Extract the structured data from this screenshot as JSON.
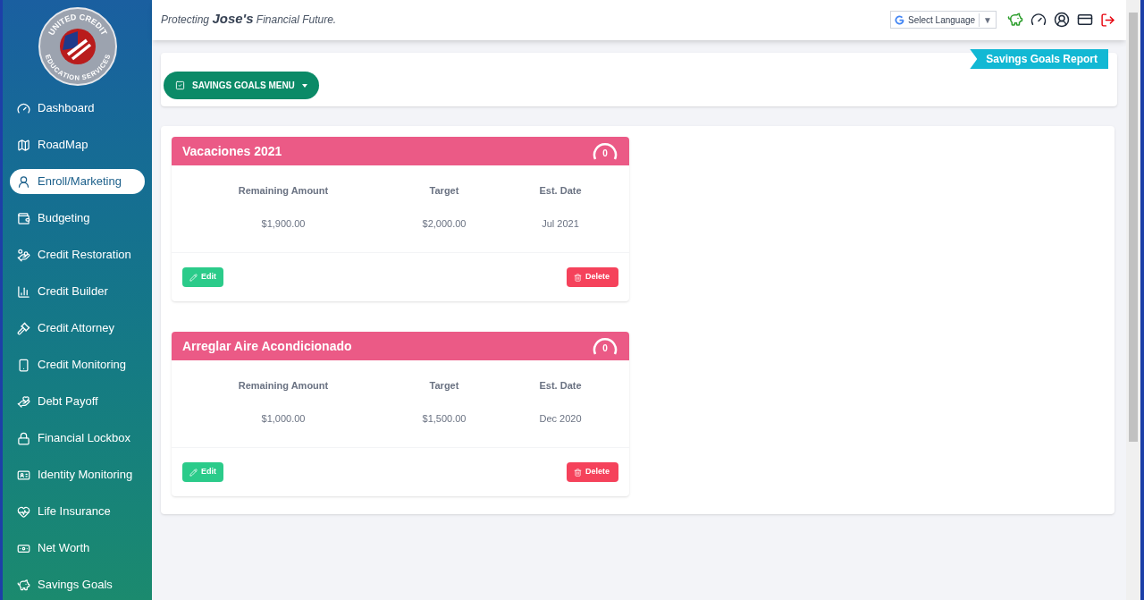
{
  "logo": {
    "text_top": "UNITED CREDIT",
    "text_bottom": "EDUCATION SERVICES"
  },
  "sidebar": {
    "items": [
      {
        "label": "Dashboard",
        "selected": false
      },
      {
        "label": "RoadMap",
        "selected": false
      },
      {
        "label": "Enroll/Marketing",
        "selected": true
      },
      {
        "label": "Budgeting",
        "selected": false
      },
      {
        "label": "Credit Restoration",
        "selected": false
      },
      {
        "label": "Credit Builder",
        "selected": false
      },
      {
        "label": "Credit Attorney",
        "selected": false
      },
      {
        "label": "Credit Monitoring",
        "selected": false
      },
      {
        "label": "Debt Payoff",
        "selected": false
      },
      {
        "label": "Financial Lockbox",
        "selected": false
      },
      {
        "label": "Identity Monitoring",
        "selected": false
      },
      {
        "label": "Life Insurance",
        "selected": false
      },
      {
        "label": "Net Worth",
        "selected": false
      },
      {
        "label": "Savings Goals",
        "selected": false
      }
    ]
  },
  "header": {
    "tagline": "Protecting **Jose's** Financial Future.",
    "language_select": "Select Language",
    "language_caret": "▼"
  },
  "toolbar": {
    "menu_button": "SAVINGS GOALS MENU",
    "report_ribbon": "Savings Goals Report"
  },
  "goals": [
    {
      "title": "Vacaciones 2021",
      "gauge": "0",
      "columns": [
        "Remaining Amount",
        "Target",
        "Est. Date"
      ],
      "values": [
        "$1,900.00",
        "$2,000.00",
        "Jul 2021"
      ],
      "edit": "Edit",
      "delete": "Delete"
    },
    {
      "title": "Arreglar Aire Acondicionado",
      "gauge": "0",
      "columns": [
        "Remaining Amount",
        "Target",
        "Est. Date"
      ],
      "values": [
        "$1,000.00",
        "$1,500.00",
        "Dec 2020"
      ],
      "edit": "Edit",
      "delete": "Delete"
    }
  ]
}
